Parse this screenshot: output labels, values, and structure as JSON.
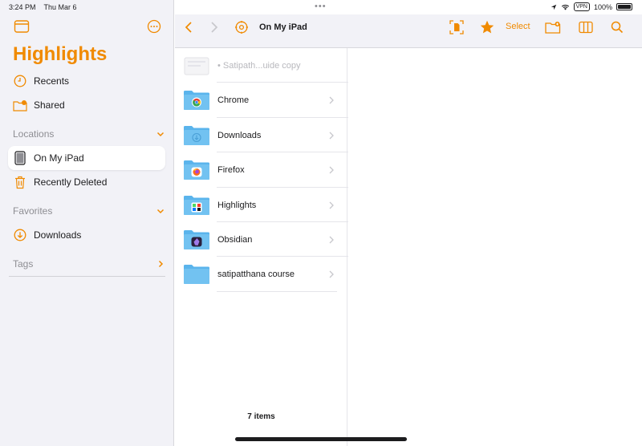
{
  "status": {
    "time": "3:24 PM",
    "date": "Thu Mar 6",
    "vpn": "VPN",
    "battery": "100%"
  },
  "sidebar": {
    "title": "Highlights",
    "items": [
      {
        "label": "Recents",
        "icon": "clock-icon"
      },
      {
        "label": "Shared",
        "icon": "shared-folder-icon"
      }
    ],
    "locations": {
      "header": "Locations",
      "items": [
        {
          "label": "On My iPad",
          "icon": "ipad-icon",
          "selected": true
        },
        {
          "label": "Recently Deleted",
          "icon": "trash-icon"
        }
      ]
    },
    "favorites": {
      "header": "Favorites",
      "items": [
        {
          "label": "Downloads",
          "icon": "download-circle-icon"
        }
      ]
    },
    "tags": {
      "header": "Tags"
    }
  },
  "toolbar": {
    "title": "On My iPad",
    "select_label": "Select"
  },
  "files": [
    {
      "name": "• Satipath...uide copy",
      "type": "ghost-document"
    },
    {
      "name": "Chrome",
      "badge": "chrome"
    },
    {
      "name": "Downloads",
      "badge": "download"
    },
    {
      "name": "Firefox",
      "badge": "firefox"
    },
    {
      "name": "Highlights",
      "badge": "highlights"
    },
    {
      "name": "Obsidian",
      "badge": "obsidian"
    },
    {
      "name": "satipatthana course",
      "badge": "none"
    }
  ],
  "items_count": "7 items",
  "colors": {
    "accent": "#f08a00",
    "folder": "#5ab4ec",
    "sidebar_bg": "#f2f2f7"
  }
}
